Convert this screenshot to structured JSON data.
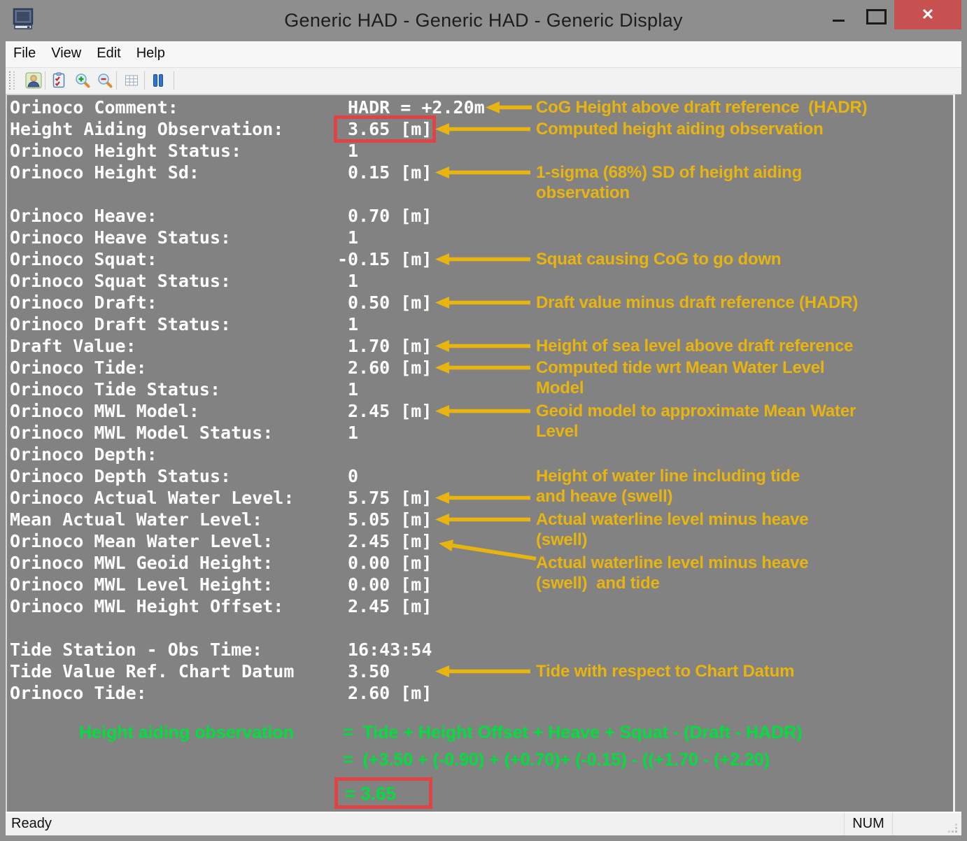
{
  "window": {
    "title": "Generic HAD - Generic HAD  - Generic Display",
    "app_icon": "computer-monitor-icon",
    "status_ready": "Ready",
    "status_num": "NUM"
  },
  "menu": {
    "items": [
      "File",
      "View",
      "Edit",
      "Help"
    ]
  },
  "toolbar": {
    "buttons": [
      "user-icon",
      "checklist-icon",
      "zoom-in-icon",
      "zoom-out-icon",
      "grid-icon",
      "pause-icon"
    ]
  },
  "display": {
    "rows": [
      {
        "label": "Orinoco Comment:",
        "value": "HADR = +2.20m"
      },
      {
        "label": "Height Aiding Observation:",
        "value": "3.65 [m]",
        "highlight": true
      },
      {
        "label": "Orinoco Height Status:",
        "value": "1"
      },
      {
        "label": "Orinoco Height Sd:",
        "value": "0.15 [m]"
      },
      {
        "label": "",
        "value": ""
      },
      {
        "label": "Orinoco Heave:",
        "value": "0.70 [m]"
      },
      {
        "label": "Orinoco Heave Status:",
        "value": "1"
      },
      {
        "label": "Orinoco Squat:",
        "value": "-0.15 [m]"
      },
      {
        "label": "Orinoco Squat Status:",
        "value": "1"
      },
      {
        "label": "Orinoco Draft:",
        "value": "0.50 [m]"
      },
      {
        "label": "Orinoco Draft Status:",
        "value": "1"
      },
      {
        "label": "Draft Value:",
        "value": "1.70 [m]"
      },
      {
        "label": "Orinoco Tide:",
        "value": "2.60 [m]"
      },
      {
        "label": "Orinoco Tide Status:",
        "value": "1"
      },
      {
        "label": "Orinoco MWL Model:",
        "value": "2.45 [m]"
      },
      {
        "label": "Orinoco MWL Model Status:",
        "value": "1"
      },
      {
        "label": "Orinoco Depth:",
        "value": ""
      },
      {
        "label": "Orinoco Depth Status:",
        "value": "0"
      },
      {
        "label": "Orinoco Actual Water Level:",
        "value": "5.75 [m]"
      },
      {
        "label": "Mean Actual Water Level:",
        "value": "5.05 [m]"
      },
      {
        "label": "Orinoco Mean Water Level:",
        "value": "2.45 [m]"
      },
      {
        "label": "Orinoco MWL Geoid Height:",
        "value": "0.00 [m]"
      },
      {
        "label": "Orinoco MWL Level Height:",
        "value": "0.00 [m]"
      },
      {
        "label": "Orinoco MWL Height Offset:",
        "value": "2.45 [m]"
      },
      {
        "label": "",
        "value": ""
      },
      {
        "label": "Tide Station - Obs Time:",
        "value": "16:43:54"
      },
      {
        "label": "Tide Value Ref. Chart Datum",
        "value": "3.50"
      },
      {
        "label": "Orinoco Tide:",
        "value": "2.60 [m]"
      }
    ],
    "annotations": [
      {
        "lines": [
          "CoG Height above draft reference  (HADR)"
        ],
        "arrow": "short",
        "text_row": 0,
        "arrow_row": 0
      },
      {
        "lines": [
          "Computed height aiding observation"
        ],
        "arrow": "normal",
        "text_row": 1,
        "arrow_row": 1
      },
      {
        "lines": [
          "1-sigma (68%) SD of height aiding",
          "observation"
        ],
        "arrow": "normal",
        "text_row": 3,
        "arrow_row": 3
      },
      {
        "lines": [
          "Squat causing CoG to go down"
        ],
        "arrow": "normal",
        "text_row": 7,
        "arrow_row": 7
      },
      {
        "lines": [
          "Draft value minus draft reference (HADR)"
        ],
        "arrow": "normal",
        "text_row": 9,
        "arrow_row": 9
      },
      {
        "lines": [
          "Height of sea level above draft reference"
        ],
        "arrow": "normal",
        "text_row": 11,
        "arrow_row": 11
      },
      {
        "lines": [
          "Computed tide wrt Mean Water Level",
          "Model"
        ],
        "arrow": "normal",
        "text_row": 12,
        "arrow_row": 12
      },
      {
        "lines": [
          "Geoid model to approximate Mean Water",
          "Level"
        ],
        "arrow": "normal",
        "text_row": 14,
        "arrow_row": 14
      },
      {
        "lines": [
          "Height of water line including tide",
          "and heave (swell)"
        ],
        "arrow": "normal",
        "text_row": 17,
        "arrow_row": 18
      },
      {
        "lines": [
          "Actual waterline level minus heave",
          "(swell)"
        ],
        "arrow": "normal",
        "text_row": 19,
        "arrow_row": 19
      },
      {
        "lines": [
          "Actual waterline level minus heave",
          "(swell)  and tide"
        ],
        "arrow": "diagonal",
        "text_row": 21,
        "arrow_row": 20
      },
      {
        "lines": [
          "Tide with respect to Chart Datum"
        ],
        "arrow": "normal",
        "text_row": 26,
        "arrow_row": 26
      }
    ],
    "formula": {
      "label": "Height aiding observation",
      "lines": [
        "=  Tide + Height Offset + Heave + Squat - (Draft - HADR)",
        "=  (+3.50 + (-0.90) + (+0.70)+ (-0.15) - ((+1.70 - (+2.20)"
      ],
      "result": "= 3.65"
    }
  },
  "colors": {
    "annotation_yellow": "#e8b40f",
    "formula_green": "#00df3d",
    "highlight_red": "#e04343",
    "close_button_red": "#c75050"
  }
}
